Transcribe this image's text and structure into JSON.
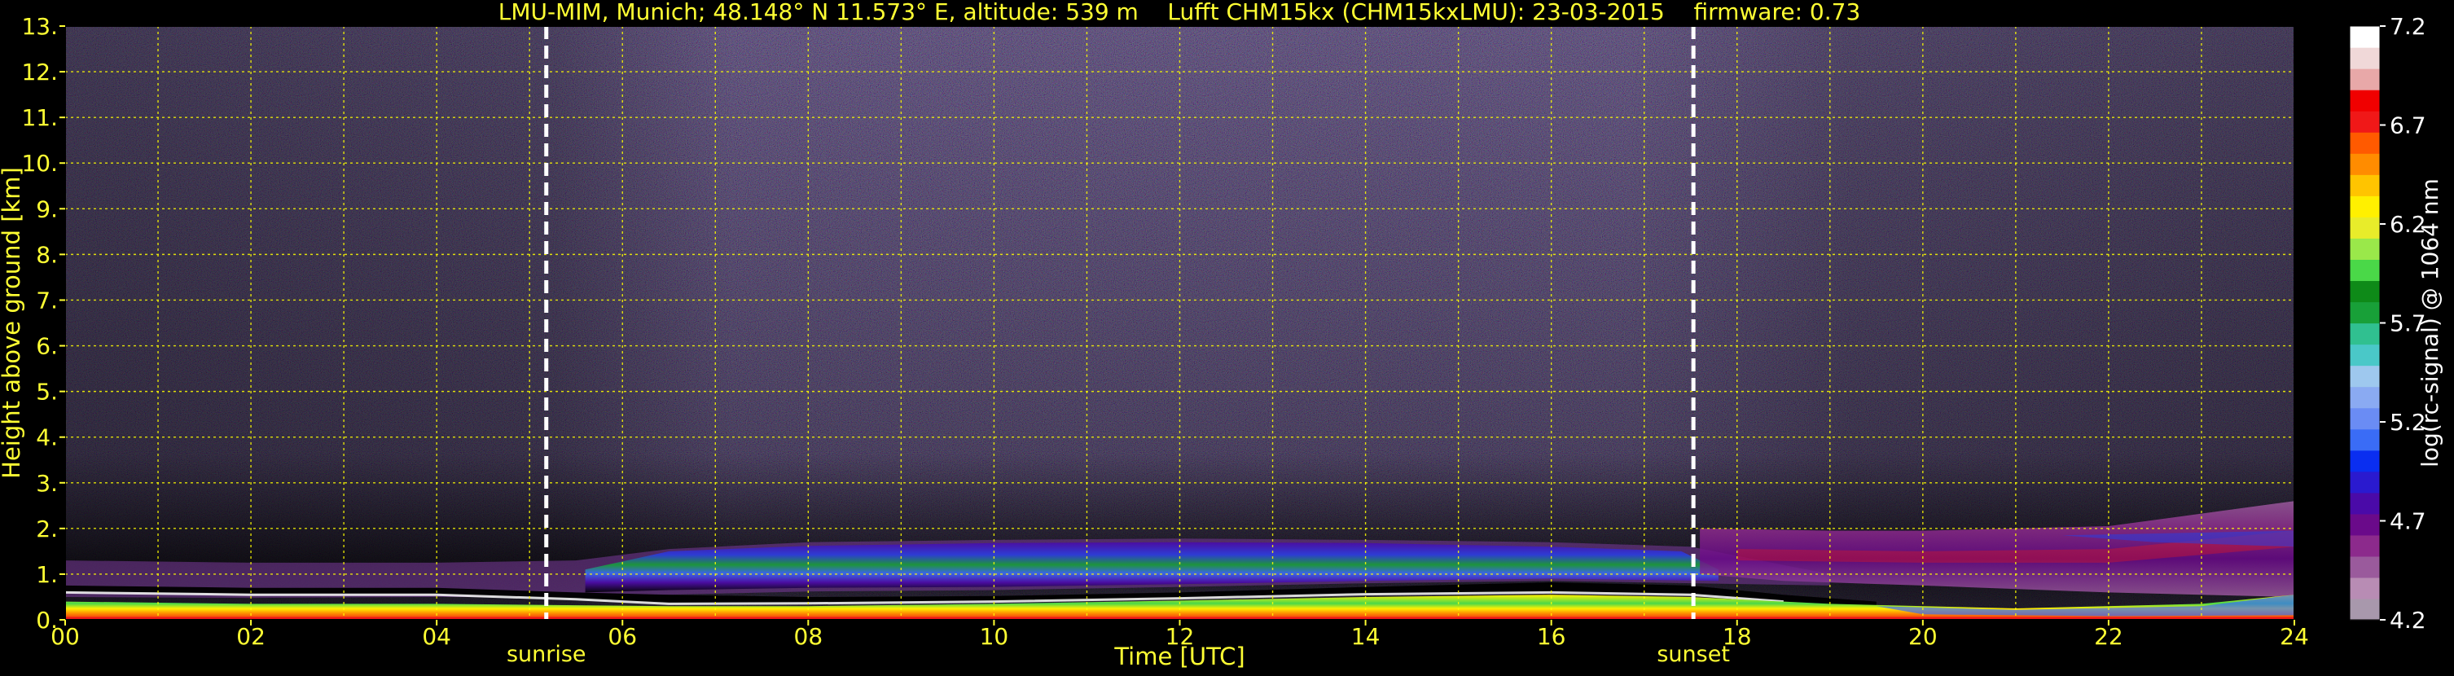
{
  "colors": {
    "background": "#000000",
    "text": "#ffff33",
    "grid": "#ffff00",
    "marker": "#ffffff",
    "colorbar_label": "#ffffff"
  },
  "chart_data": {
    "type": "heatmap",
    "title": "LMU-MIM, Munich; 48.148° N 11.573° E, altitude: 539 m    Lufft CHM15kx (CHM15kxLMU): 23-03-2015    firmware: 0.73",
    "xlabel": "Time [UTC]",
    "ylabel": "Height above ground [km]",
    "xlim": [
      0,
      24
    ],
    "ylim": [
      0,
      13
    ],
    "x_ticks": [
      "00",
      "02",
      "04",
      "06",
      "08",
      "10",
      "12",
      "14",
      "16",
      "18",
      "20",
      "22",
      "24"
    ],
    "x_tick_values": [
      0,
      2,
      4,
      6,
      8,
      10,
      12,
      14,
      16,
      18,
      20,
      22,
      24
    ],
    "y_ticks": [
      "0.",
      "1.",
      "2.",
      "3.",
      "4.",
      "5.",
      "6.",
      "7.",
      "8.",
      "9.",
      "10.",
      "11.",
      "12.",
      "13."
    ],
    "y_tick_values": [
      0,
      1,
      2,
      3,
      4,
      5,
      6,
      7,
      8,
      9,
      10,
      11,
      12,
      13
    ],
    "grid": true,
    "grid_x": [
      1,
      2,
      3,
      4,
      5,
      6,
      7,
      8,
      9,
      10,
      11,
      12,
      13,
      14,
      15,
      16,
      17,
      18,
      19,
      20,
      21,
      22,
      23
    ],
    "markers": [
      {
        "label": "sunrise",
        "x": 5.18
      },
      {
        "label": "sunset",
        "x": 17.53
      }
    ],
    "colorbar": {
      "label": "log(rc-signal) @ 1064 nm",
      "range": [
        4.2,
        7.2
      ],
      "ticks": [
        "7.2",
        "6.7",
        "6.2",
        "5.7",
        "5.2",
        "4.7",
        "4.2"
      ],
      "tick_values": [
        7.2,
        6.7,
        6.2,
        5.7,
        5.2,
        4.7,
        4.2
      ],
      "colors": [
        "#a898ac",
        "#b88cb4",
        "#9a5a9c",
        "#8c2a8c",
        "#6a0a8a",
        "#4a0aa8",
        "#2a1acf",
        "#0a2ef0",
        "#3a6cf6",
        "#6a8cf4",
        "#8aaaf2",
        "#9ec8ee",
        "#4ac8c8",
        "#30c090",
        "#18a038",
        "#0e8a18",
        "#4ad848",
        "#9ae84a",
        "#e8ec2a",
        "#fff000",
        "#ffc400",
        "#ff8c00",
        "#ff5a00",
        "#f01818",
        "#f00000",
        "#e8a8a8",
        "#f0d8d8",
        "#ffffff"
      ]
    }
  }
}
